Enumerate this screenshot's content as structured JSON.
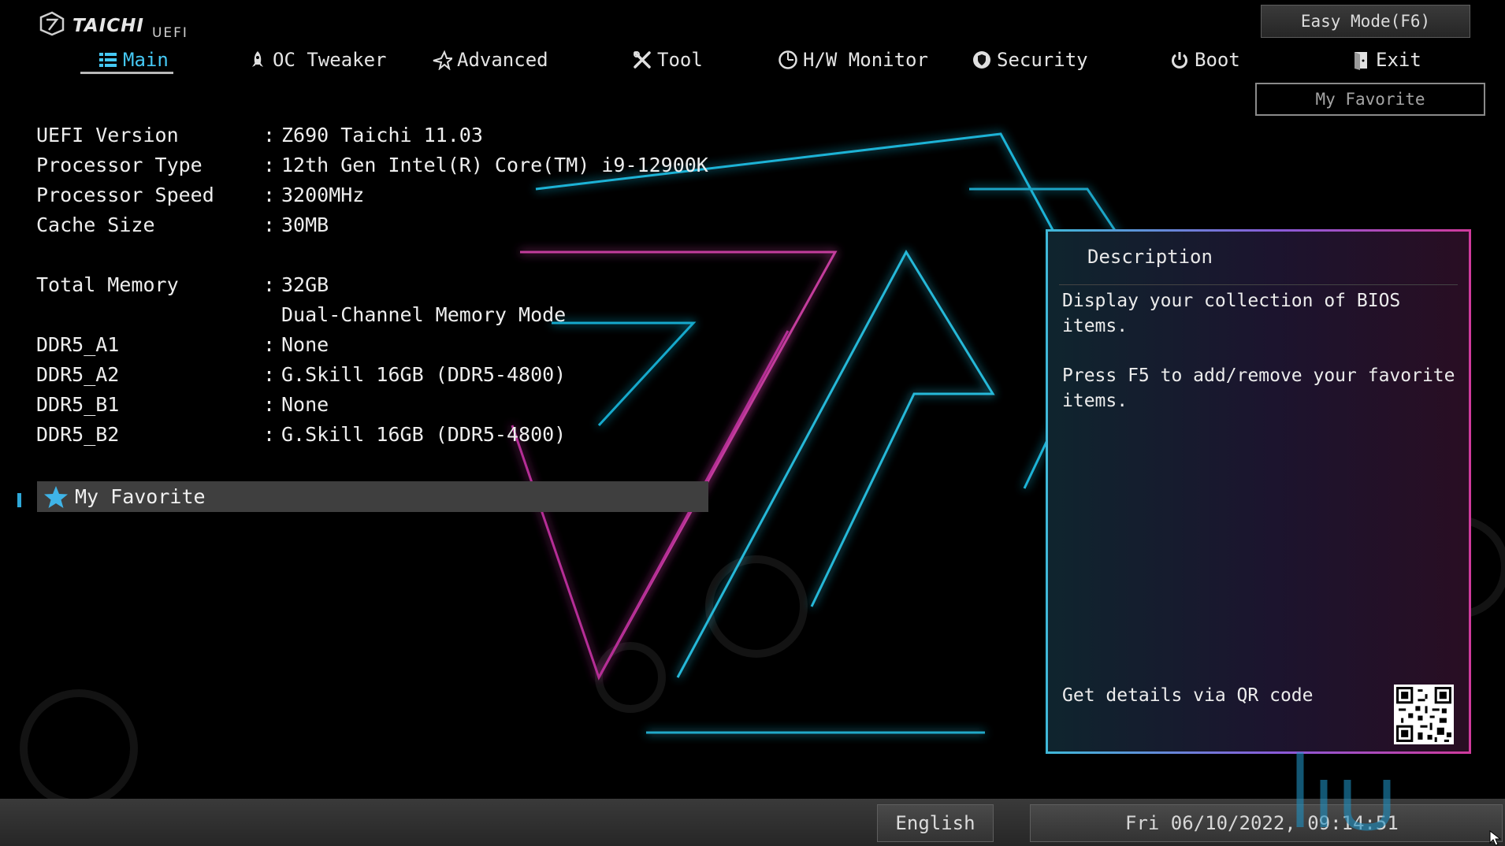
{
  "brand": {
    "name": "TAICHI",
    "sub": "UEFI"
  },
  "nav": {
    "tabs": [
      {
        "label": "Main",
        "icon": "list-icon",
        "active": true
      },
      {
        "label": "OC Tweaker",
        "icon": "rocket-icon"
      },
      {
        "label": "Advanced",
        "icon": "star-icon"
      },
      {
        "label": "Tool",
        "icon": "wrench-icon"
      },
      {
        "label": "H/W Monitor",
        "icon": "monitor-gauge-icon"
      },
      {
        "label": "Security",
        "icon": "shield-icon"
      },
      {
        "label": "Boot",
        "icon": "power-icon"
      },
      {
        "label": "Exit",
        "icon": "door-exit-icon"
      }
    ],
    "easy_mode": "Easy Mode(F6)",
    "my_favorite": "My Favorite"
  },
  "info": [
    {
      "label": "UEFI Version",
      "sep": ":",
      "value": "Z690 Taichi 11.03"
    },
    {
      "label": "Processor Type",
      "sep": ":",
      "value": "12th Gen Intel(R) Core(TM) i9-12900K"
    },
    {
      "label": "Processor Speed",
      "sep": ":",
      "value": "3200MHz"
    },
    {
      "label": "Cache Size",
      "sep": ":",
      "value": "30MB"
    },
    {
      "label": "Total Memory",
      "sep": ":",
      "value": "32GB"
    },
    {
      "label": "",
      "sep": "",
      "value": "Dual-Channel Memory Mode"
    },
    {
      "label": "DDR5_A1",
      "sep": ":",
      "value": "None"
    },
    {
      "label": "DDR5_A2",
      "sep": ":",
      "value": "G.Skill 16GB (DDR5-4800)"
    },
    {
      "label": "DDR5_B1",
      "sep": ":",
      "value": "None"
    },
    {
      "label": "DDR5_B2",
      "sep": ":",
      "value": "G.Skill 16GB (DDR5-4800)"
    }
  ],
  "favorite_item": {
    "label": "My Favorite",
    "icon": "star-icon"
  },
  "description": {
    "title": "Description",
    "paragraphs": [
      "Display your collection of BIOS items.",
      "Press F5 to add/remove your favorite items."
    ],
    "qr_text": "Get details via QR code"
  },
  "footer": {
    "language": "English",
    "datetime": "Fri 06/10/2022, 09:14:51"
  },
  "colors": {
    "accent": "#45c8f4",
    "panel_border_start": "#3fb9d8",
    "panel_border_end": "#d03a9c"
  }
}
